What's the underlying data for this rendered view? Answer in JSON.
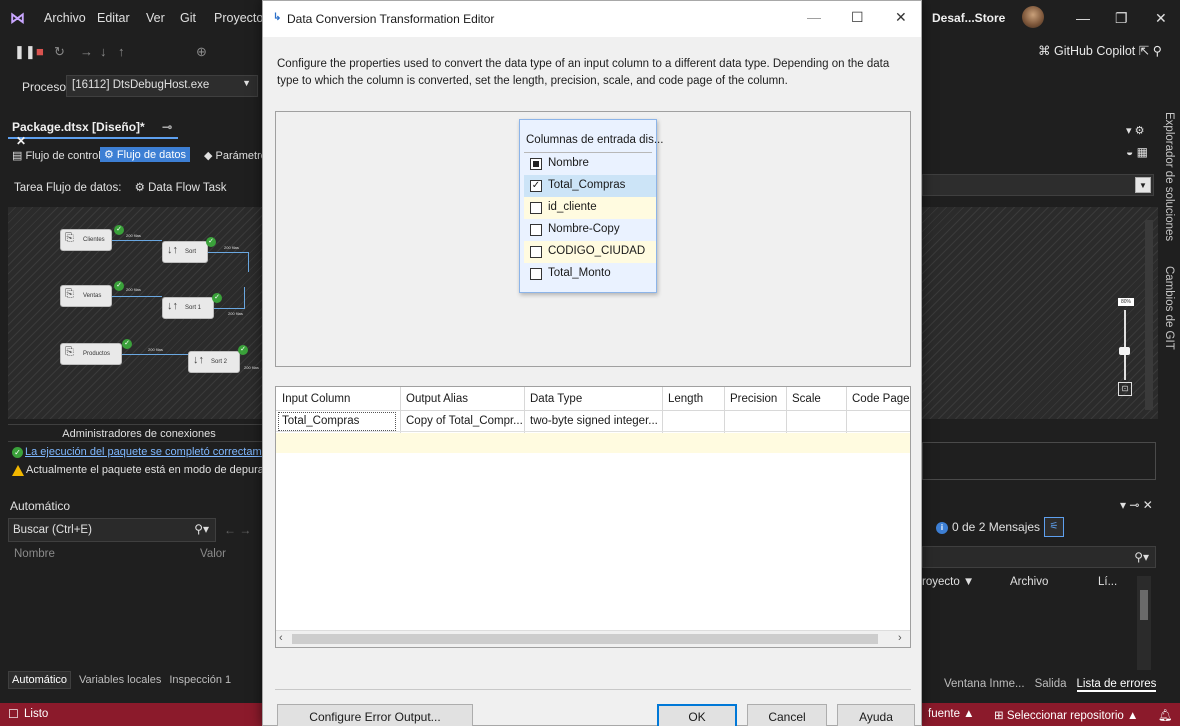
{
  "vs": {
    "menu": [
      "Archivo",
      "Editar",
      "Ver",
      "Git",
      "Proyecto"
    ],
    "solution_badge": "Desaf...Store",
    "copilot_label": "GitHub Copilot",
    "process_label": "Proceso:",
    "process_value": "[16112] DtsDebugHost.exe",
    "doc_tab": "Package.dtsx [Diseño]*",
    "subtabs": [
      "Flujo de control",
      "Flujo de datos",
      "Parámetro"
    ],
    "task_label": "Tarea Flujo de datos:",
    "task_value": "Data Flow Task",
    "canvas_nodes": [
      "Clientes",
      "Sort",
      "Ventas",
      "Sort 1",
      "Productos",
      "Sort 2"
    ],
    "rows_label": "200 filas",
    "conn_managers": "Administradores de conexiones",
    "msg_success": "La ejecución del paquete se completó correctamente.",
    "msg_debug": "Actualmente el paquete está en modo de depuración;",
    "auto_panel_title": "Automático",
    "search_placeholder": "Buscar (Ctrl+E)",
    "col_name": "Nombre",
    "col_value": "Valor",
    "bottom_tabs": [
      "Automático",
      "Variables locales",
      "Inspección 1"
    ],
    "status_left": "Listo",
    "status_right_source": "fuente",
    "status_right_repo": "Seleccionar repositorio",
    "right_rail": [
      "Explorador de soluciones",
      "Cambios de GIT"
    ],
    "zoom": "80%",
    "messages": "0 de 2 Mensajes",
    "error_cols": [
      "royecto",
      "Archivo",
      "Lí..."
    ],
    "right_tabs": [
      "Ventana Inme...",
      "Salida",
      "Lista de errores"
    ]
  },
  "dialog": {
    "title": "Data Conversion Transformation Editor",
    "description": "Configure the properties used to convert the data type of an input column to a different data type. Depending on the data type to which the column is converted, set the length, precision, scale, and code page of the column.",
    "columns_box": {
      "header": "Columnas de entrada dis...",
      "items": [
        {
          "label": "Nombre",
          "state": "indeterminate"
        },
        {
          "label": "Total_Compras",
          "state": "checked"
        },
        {
          "label": "id_cliente",
          "state": "unchecked"
        },
        {
          "label": "Nombre-Copy",
          "state": "unchecked"
        },
        {
          "label": "CODIGO_CIUDAD",
          "state": "unchecked"
        },
        {
          "label": "Total_Monto",
          "state": "unchecked"
        }
      ]
    },
    "grid": {
      "headers": [
        "Input Column",
        "Output Alias",
        "Data Type",
        "Length",
        "Precision",
        "Scale",
        "Code Page"
      ],
      "rows": [
        [
          "Total_Compras",
          "Copy of Total_Compr...",
          "two-byte signed integer...",
          "",
          "",
          "",
          ""
        ]
      ]
    },
    "buttons": {
      "configure_error": "Configure Error Output...",
      "ok": "OK",
      "cancel": "Cancel",
      "help": "Ayuda"
    }
  }
}
